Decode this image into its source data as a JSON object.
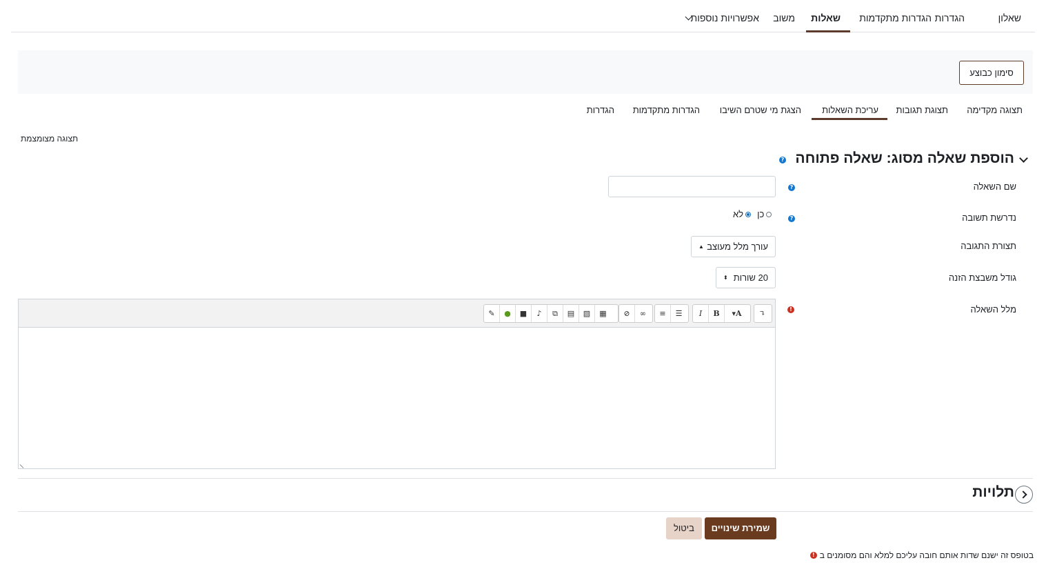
{
  "top_nav": {
    "items": [
      "שאלון",
      "הגדרות",
      "הגדרות מתקדמות",
      "שאלות",
      "משוב"
    ],
    "more": "אפשרויות נוספות"
  },
  "header": {
    "mark_done_button": "סימון כבוצע"
  },
  "sub_tabs": [
    "תצוגה מקדימה",
    "תצוגת תגובות",
    "עריכת השאלות",
    "הצגת מי שטרם השיבו",
    "הגדרות מתקדמות",
    "הגדרות"
  ],
  "compact_view": "תצוגה מצומצמת",
  "form": {
    "title": "הוספת שאלה מסוג: שאלה פתוחה",
    "question_name_label": "שם השאלה",
    "required_label": "נדרשת תשובה",
    "required_yes": "כן",
    "required_no": "לא",
    "response_format_label": "תצורת התגובה",
    "response_format_value": "עורך מלל מעוצב",
    "input_size_label": "גודל משבצת הזנה",
    "input_size_value": "20 שורות",
    "question_text_label": "מלל השאלה"
  },
  "tags": {
    "title": "תלויות"
  },
  "actions": {
    "save": "שמירת שינויים",
    "cancel": "ביטול"
  },
  "footnote": "בטופס זה ישנם שדות אותם חובה עליכם למלא והם מסומנים ב",
  "colors": {
    "accent": "#5c3b2a",
    "primary_button": "#6a3b1f",
    "secondary_button": "#e8d3c8",
    "help_icon": "#1177d1",
    "required_icon": "#ca3120"
  }
}
